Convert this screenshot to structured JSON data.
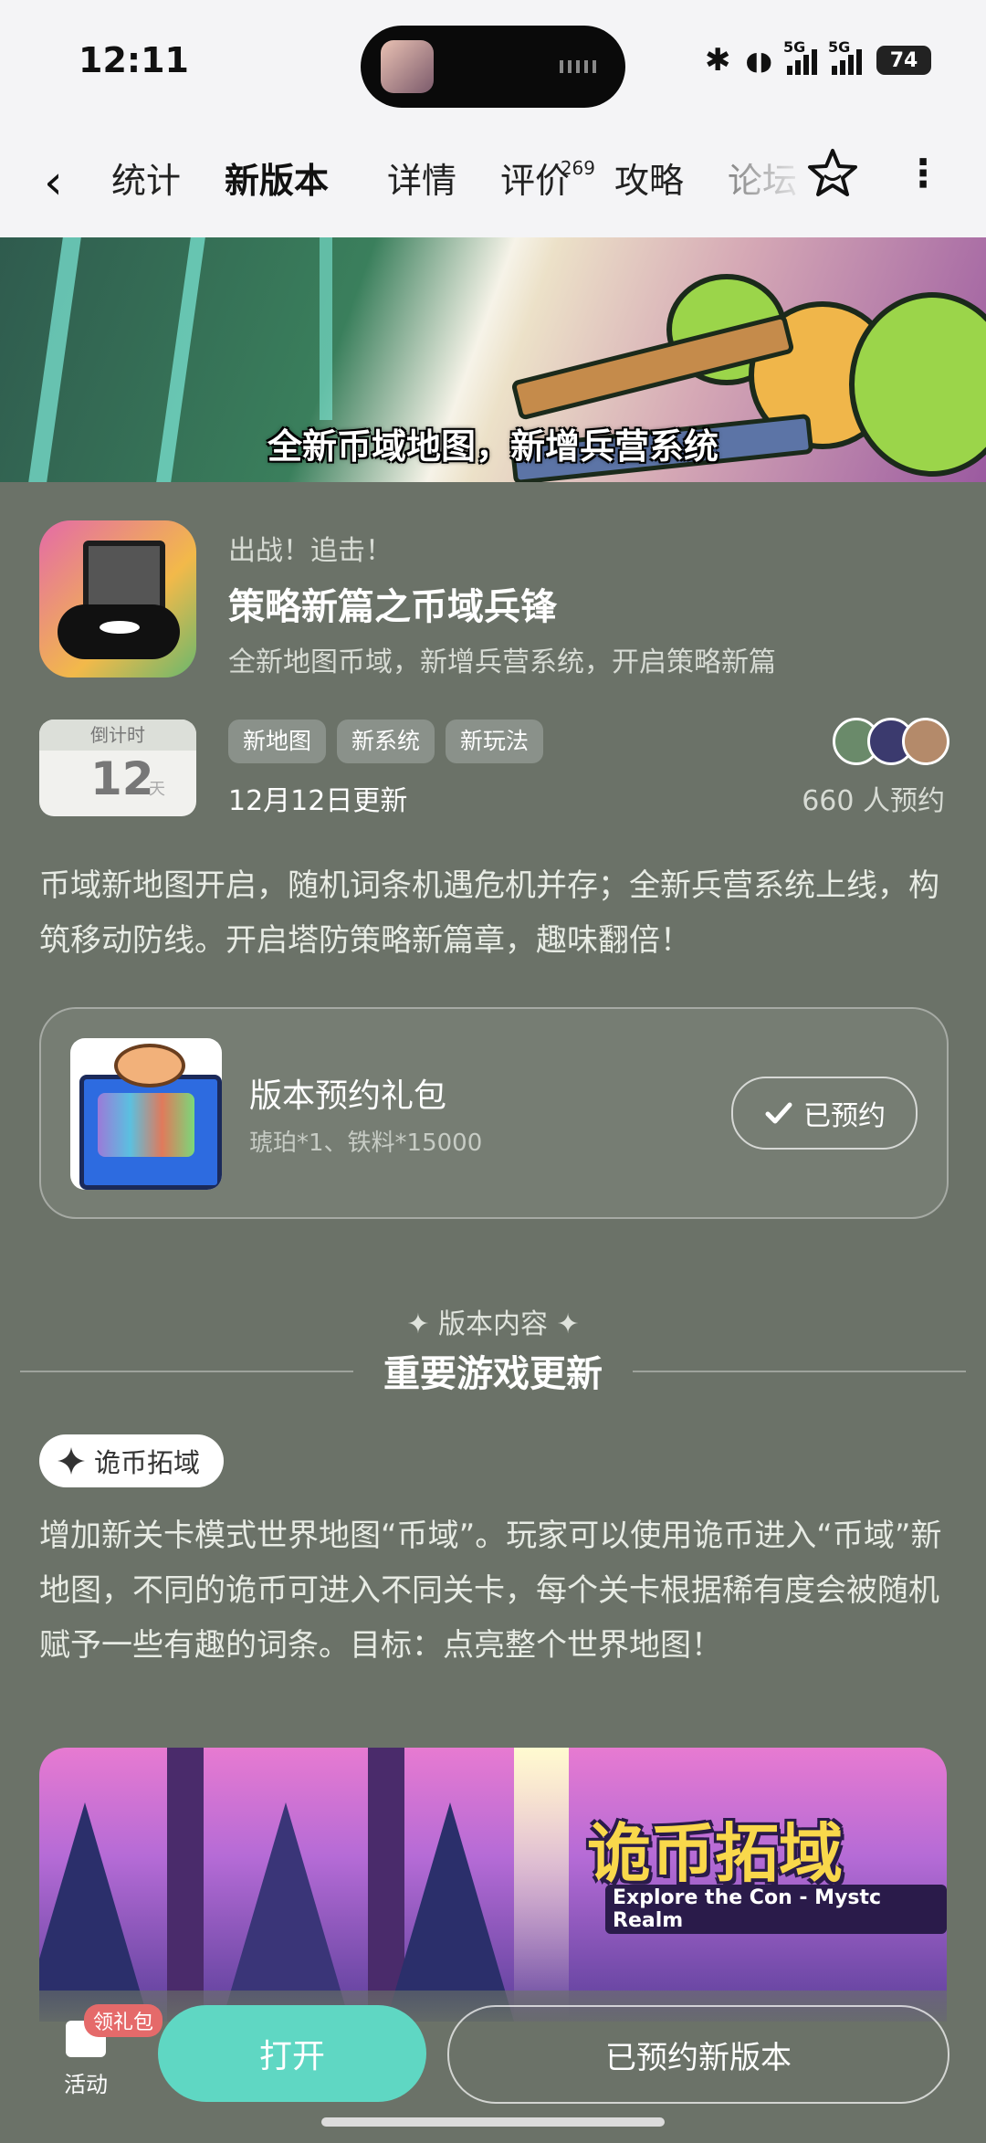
{
  "status_bar": {
    "time": "12:11",
    "signal1": "5G",
    "signal2": "5G",
    "battery": "74"
  },
  "nav": {
    "tabs": [
      {
        "label": "统计"
      },
      {
        "label": "新版本"
      },
      {
        "label": "详情"
      },
      {
        "label": "评价",
        "badge": "269"
      },
      {
        "label": "攻略"
      },
      {
        "label": "论坛"
      }
    ],
    "active_tab": "新版本",
    "accent": "#5fd7c3"
  },
  "banner": {
    "caption": "全新币域地图，新增兵营系统"
  },
  "app": {
    "subtitle": "出战！追击！",
    "title": "策略新篇之币域兵锋",
    "description": "全新地图币域，新增兵营系统，开启策略新篇"
  },
  "countdown": {
    "label": "倒计时",
    "value": "12",
    "unit": "天"
  },
  "tags": [
    "新地图",
    "新系统",
    "新玩法"
  ],
  "update_date": "12月12日更新",
  "reservations": "660 人预约",
  "intro": "币域新地图开启，随机词条机遇危机并存；全新兵营系统上线，构筑移动防线。开启塔防策略新篇章，趣味翻倍！",
  "gift": {
    "title": "版本预约礼包",
    "contents": "琥珀*1、铁料*15000",
    "button": "已预约"
  },
  "section": {
    "kicker": "✦ 版本内容 ✦",
    "heading": "重要游戏更新"
  },
  "feature": {
    "chip": "诡币拓域",
    "text": "增加新关卡模式世界地图“币域”。玩家可以使用诡币进入“币域”新地图，不同的诡币可进入不同关卡，每个关卡根据稀有度会被随机赋予一些有趣的词条。目标：点亮整个世界地图！",
    "image_title": "诡币拓域",
    "image_subtitle": "Explore the Con - Mystc Realm"
  },
  "bottom": {
    "activity_badge": "领礼包",
    "activity_label": "活动",
    "open_button": "打开",
    "reserve_button": "已预约新版本"
  }
}
